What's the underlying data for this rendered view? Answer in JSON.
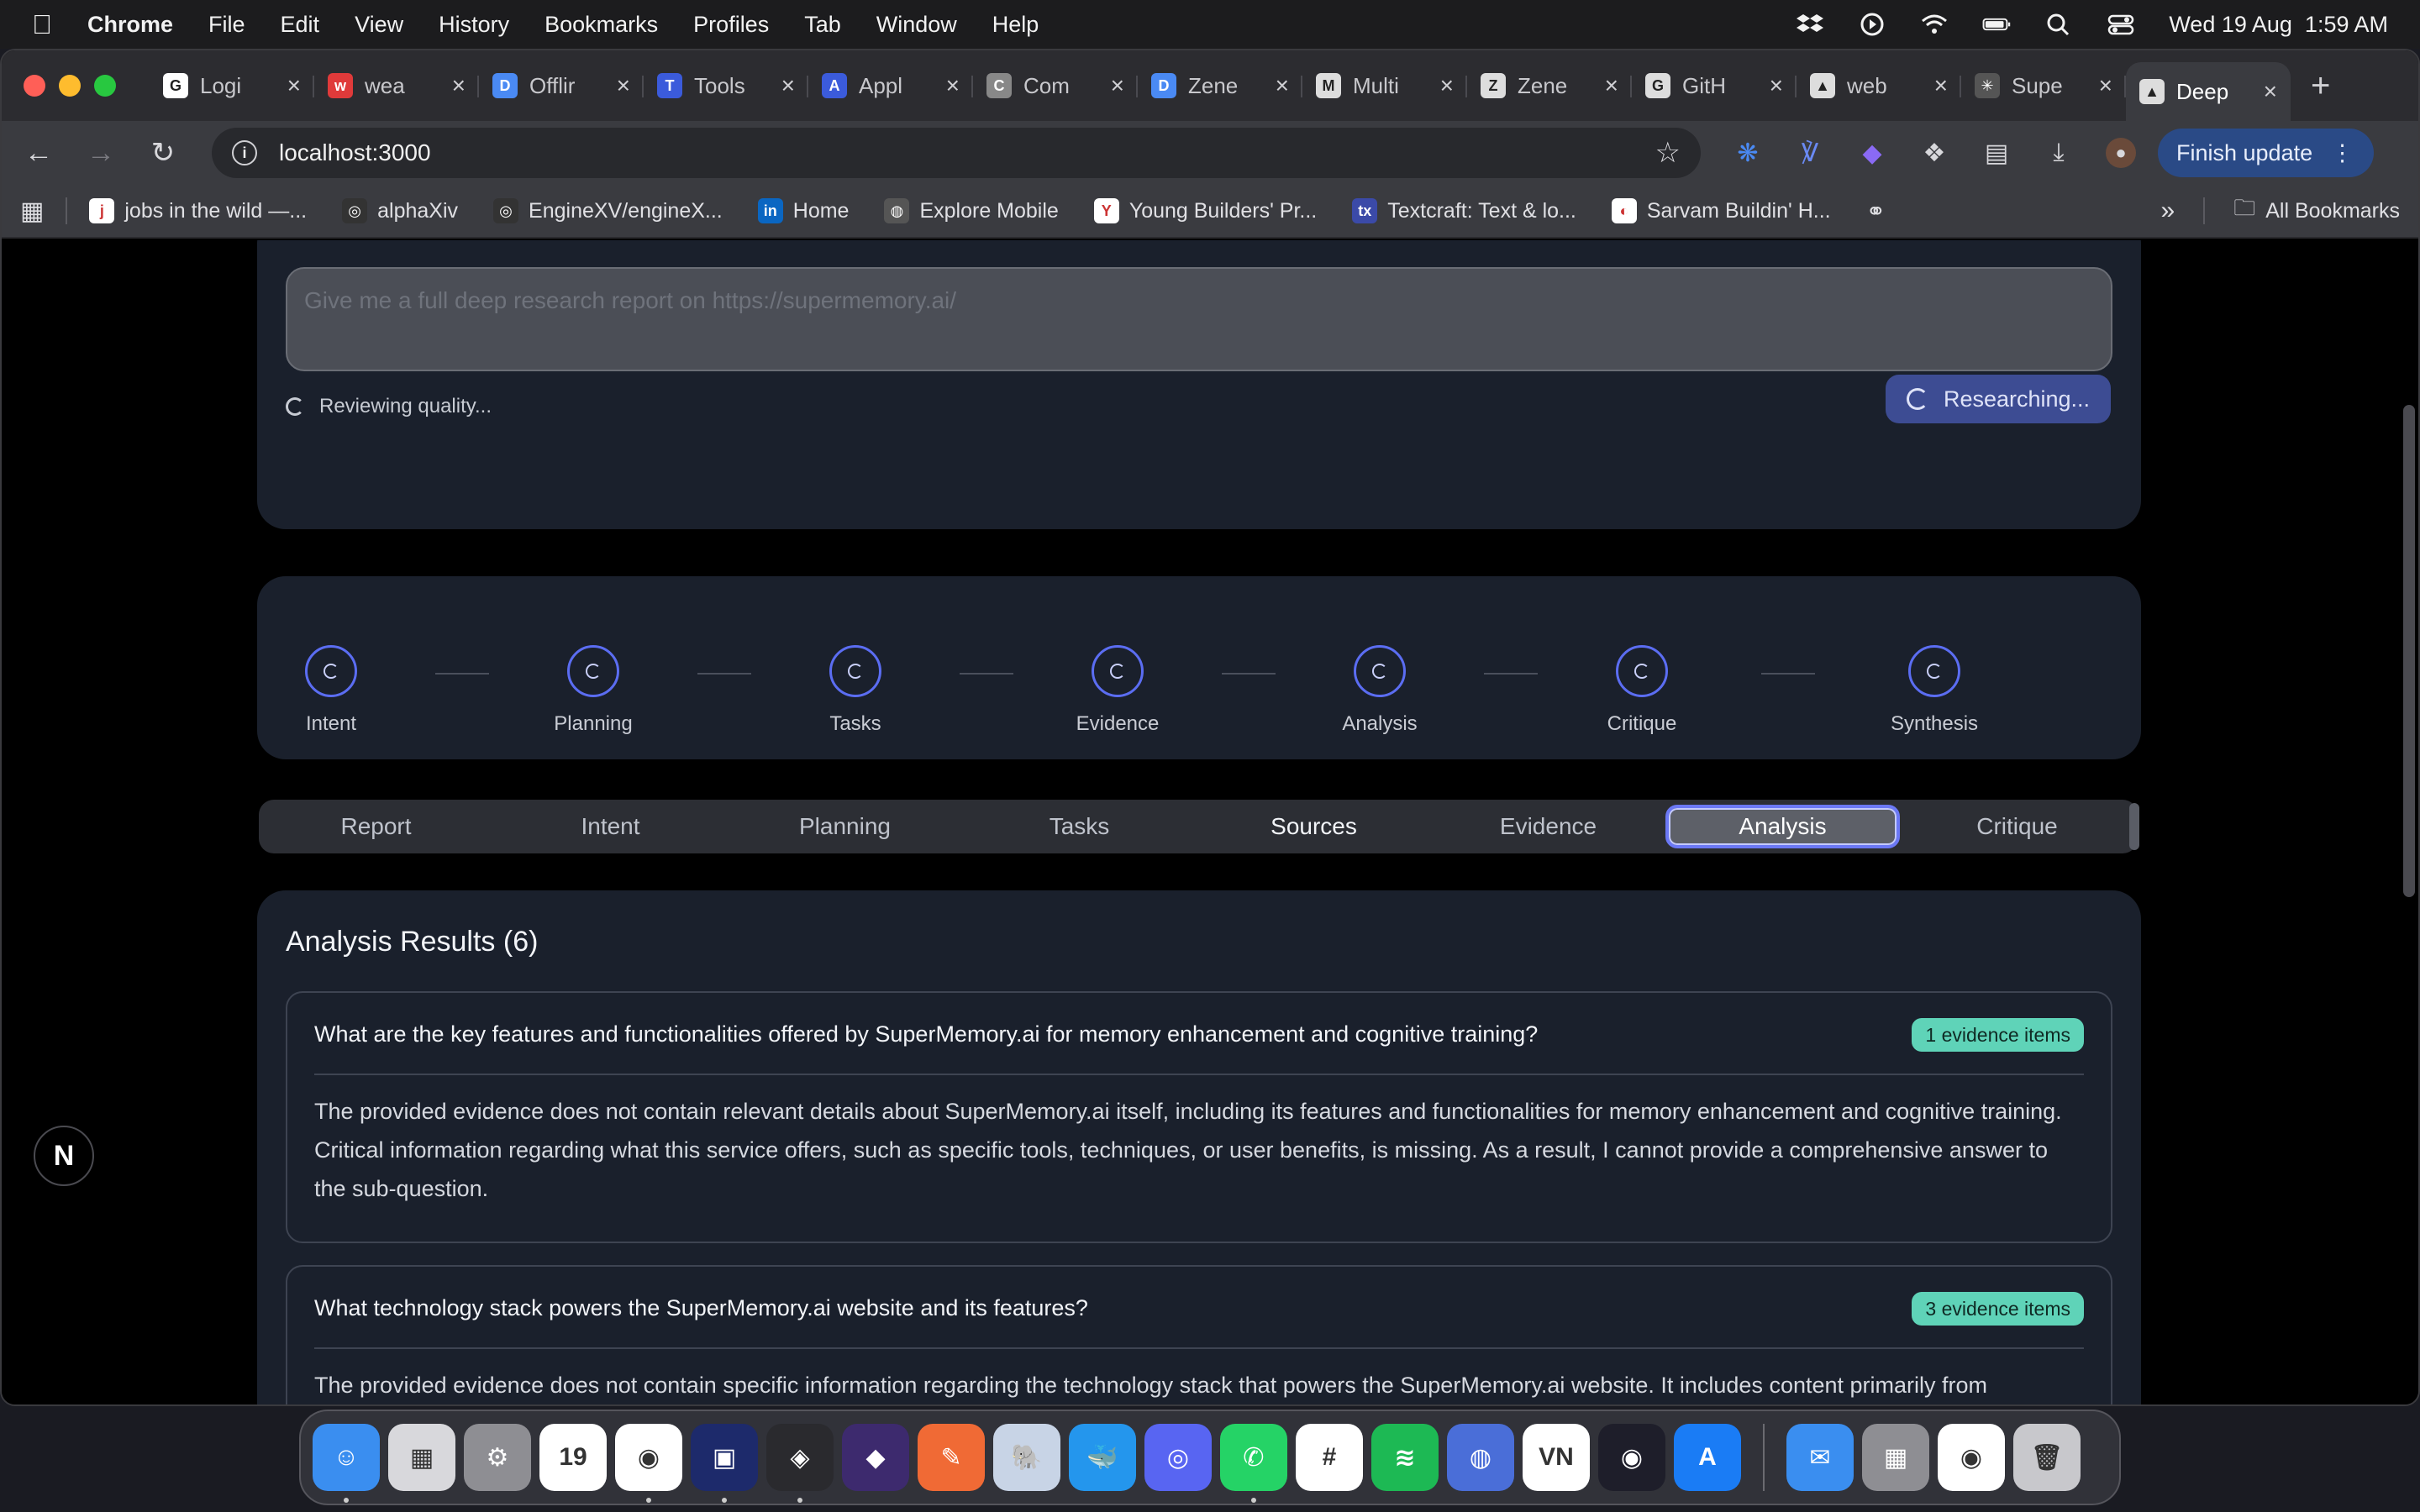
{
  "menubar": {
    "app": "Chrome",
    "items": [
      "File",
      "Edit",
      "View",
      "History",
      "Bookmarks",
      "Profiles",
      "Tab",
      "Window",
      "Help"
    ],
    "datetime": "Wed 19 Aug  1:59 AM"
  },
  "tabs": [
    {
      "label": "Logi",
      "color": "#ffffff",
      "glyph": "G"
    },
    {
      "label": "wea",
      "color": "#e03a3a",
      "glyph": "w"
    },
    {
      "label": "Offlir",
      "color": "#4a8af4",
      "glyph": "D"
    },
    {
      "label": "Tools",
      "color": "#3b5bdb",
      "glyph": "T"
    },
    {
      "label": "Appl",
      "color": "#3b5bdb",
      "glyph": "A"
    },
    {
      "label": "Com",
      "color": "#888888",
      "glyph": "C"
    },
    {
      "label": "Zene",
      "color": "#4a8af4",
      "glyph": "D"
    },
    {
      "label": "Multi",
      "color": "#dddddd",
      "glyph": "M"
    },
    {
      "label": "Zene",
      "color": "#dddddd",
      "glyph": "Z"
    },
    {
      "label": "GitH",
      "color": "#dddddd",
      "glyph": "G"
    },
    {
      "label": "web",
      "color": "#dddddd",
      "glyph": "▲"
    },
    {
      "label": "Supe",
      "color": "#555555",
      "glyph": "✳"
    },
    {
      "label": "Deep",
      "color": "#dddddd",
      "glyph": "▲"
    }
  ],
  "toolbar": {
    "url": "localhost:3000",
    "finish_update": "Finish update"
  },
  "bookmarks": [
    {
      "label": "jobs in the wild —...",
      "color": "#ffffff",
      "glyph": "j"
    },
    {
      "label": "alphaXiv",
      "color": "#333333",
      "glyph": "◎"
    },
    {
      "label": "EngineXV/engineX...",
      "color": "#333333",
      "glyph": "◎"
    },
    {
      "label": "Home",
      "color": "#0a66c2",
      "glyph": "in"
    },
    {
      "label": "Explore Mobile",
      "color": "#555555",
      "glyph": "◍"
    },
    {
      "label": "Young Builders' Pr...",
      "color": "#ffffff",
      "glyph": "Y"
    },
    {
      "label": "Textcraft: Text & lo...",
      "color": "#3b4aa8",
      "glyph": "tx"
    },
    {
      "label": "Sarvam Buildin' H...",
      "color": "#ffffff",
      "glyph": "◐"
    }
  ],
  "bookmarks_all": "All Bookmarks",
  "query": {
    "placeholder": "Give me a full deep research report on https://supermemory.ai/",
    "status": "Reviewing quality...",
    "button": "Researching..."
  },
  "pipeline": [
    "Intent",
    "Planning",
    "Tasks",
    "Evidence",
    "Analysis",
    "Critique",
    "Synthesis"
  ],
  "view_tabs": [
    "Report",
    "Intent",
    "Planning",
    "Tasks",
    "Sources",
    "Evidence",
    "Analysis",
    "Critique"
  ],
  "active_tab": "Analysis",
  "results": {
    "title": "Analysis Results (6)",
    "items": [
      {
        "question": "What are the key features and functionalities offered by SuperMemory.ai for memory enhancement and cognitive training?",
        "badge": "1 evidence items",
        "answer": "The provided evidence does not contain relevant details about SuperMemory.ai itself, including its features and functionalities for memory enhancement and cognitive training. Critical information regarding what this service offers, such as specific tools, techniques, or user benefits, is missing. As a result, I cannot provide a comprehensive answer to the sub-question."
      },
      {
        "question": "What technology stack powers the SuperMemory.ai website and its features?",
        "badge": "3 evidence items",
        "answer": "The provided evidence does not contain specific information regarding the technology stack that powers the SuperMemory.ai website. It includes content primarily from ScienceDirect, which is unrelated to the SuperMemory.ai platform. Information typically required for identifying a technology stack would include details about"
      }
    ]
  },
  "next_badge": "N",
  "dock": [
    {
      "name": "finder",
      "color": "#3a8ef0",
      "glyph": "☺",
      "dot": true
    },
    {
      "name": "launchpad",
      "color": "#d8d8dc",
      "glyph": "▦",
      "dot": false
    },
    {
      "name": "settings",
      "color": "#8e8e93",
      "glyph": "⚙",
      "dot": false
    },
    {
      "name": "calendar",
      "color": "#ffffff",
      "glyph": "19",
      "dot": false
    },
    {
      "name": "chrome",
      "color": "#ffffff",
      "glyph": "◉",
      "dot": true
    },
    {
      "name": "terminal",
      "color": "#1d2a6b",
      "glyph": "▣",
      "dot": true
    },
    {
      "name": "cube",
      "color": "#2a2a2e",
      "glyph": "◈",
      "dot": true
    },
    {
      "name": "obsidian",
      "color": "#3d2a6e",
      "glyph": "◆",
      "dot": false
    },
    {
      "name": "pencil",
      "color": "#f06a35",
      "glyph": "✎",
      "dot": false
    },
    {
      "name": "postgres",
      "color": "#c8d4e6",
      "glyph": "🐘",
      "dot": false
    },
    {
      "name": "docker",
      "color": "#2496ed",
      "glyph": "🐳",
      "dot": false
    },
    {
      "name": "discord",
      "color": "#5865f2",
      "glyph": "◎",
      "dot": false
    },
    {
      "name": "whatsapp",
      "color": "#25d366",
      "glyph": "✆",
      "dot": true
    },
    {
      "name": "slack",
      "color": "#ffffff",
      "glyph": "#",
      "dot": false
    },
    {
      "name": "spotify",
      "color": "#1db954",
      "glyph": "≋",
      "dot": false
    },
    {
      "name": "jar",
      "color": "#4a6ed8",
      "glyph": "◍",
      "dot": false
    },
    {
      "name": "vn",
      "color": "#ffffff",
      "glyph": "VN",
      "dot": false
    },
    {
      "name": "obs",
      "color": "#1e1e2a",
      "glyph": "◉",
      "dot": false
    },
    {
      "name": "app-store",
      "color": "#1a7cf5",
      "glyph": "A",
      "dot": false
    },
    {
      "name": "mail",
      "color": "#3a8ef0",
      "glyph": "✉",
      "dot": false
    },
    {
      "name": "calculator",
      "color": "#8e8e93",
      "glyph": "▦",
      "dot": false
    },
    {
      "name": "chrome-2",
      "color": "#ffffff",
      "glyph": "◉",
      "dot": false
    },
    {
      "name": "trash",
      "color": "#c8c8cc",
      "glyph": "🗑",
      "dot": false
    }
  ]
}
